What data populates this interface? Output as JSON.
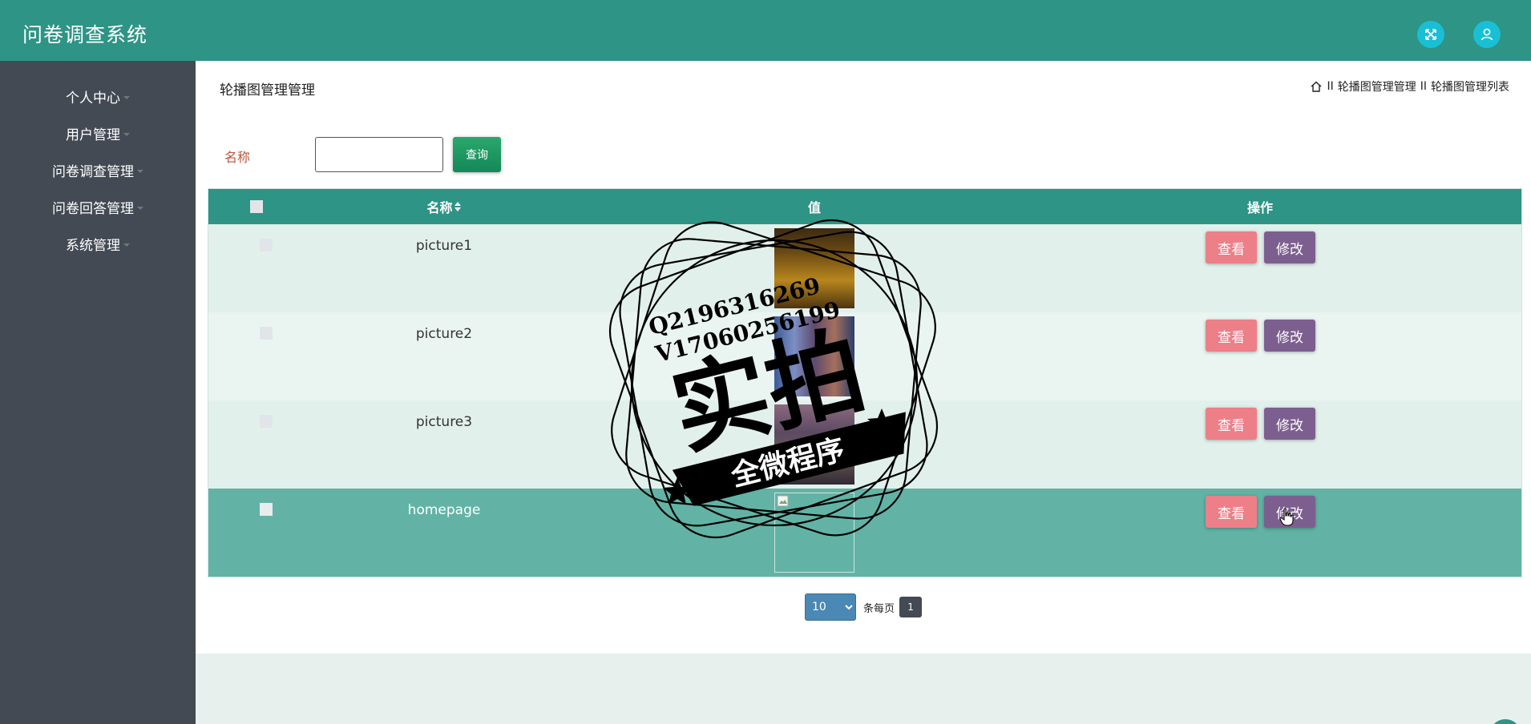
{
  "app": {
    "title": "问卷调查系统"
  },
  "header": {
    "fullscreen_icon": "fullscreen-icon",
    "user_icon": "user-icon"
  },
  "sidebar": {
    "items": [
      {
        "label": "个人中心"
      },
      {
        "label": "用户管理"
      },
      {
        "label": "问卷调查管理"
      },
      {
        "label": "问卷回答管理"
      },
      {
        "label": "系统管理"
      }
    ]
  },
  "page": {
    "title": "轮播图管理管理",
    "breadcrumb": [
      "轮播图管理管理",
      "轮播图管理列表"
    ],
    "breadcrumb_separator": "II"
  },
  "search": {
    "label": "名称",
    "value": "",
    "button_label": "查询"
  },
  "table": {
    "columns": {
      "name": "名称",
      "value": "值",
      "actions": "操作"
    },
    "rows": [
      {
        "name": "picture1",
        "view_label": "查看",
        "edit_label": "修改"
      },
      {
        "name": "picture2",
        "view_label": "查看",
        "edit_label": "修改"
      },
      {
        "name": "picture3",
        "view_label": "查看",
        "edit_label": "修改"
      },
      {
        "name": "homepage",
        "view_label": "查看",
        "edit_label": "修改"
      }
    ]
  },
  "pagination": {
    "page_size": "10",
    "page_size_options": [
      "10"
    ],
    "per_page_label": "条每页",
    "current_page": "1"
  },
  "watermark": {
    "line1": "Q2196316269",
    "line2": "V17060256199",
    "main": "实拍",
    "ribbon": "全微程序"
  },
  "colors": {
    "header": "#2e9485",
    "sidebar": "#434a54",
    "view_button": "#ec7f88",
    "edit_button": "#7d5f8f",
    "search_button": "#1f9a62",
    "row_hover": "#62b3a5"
  }
}
